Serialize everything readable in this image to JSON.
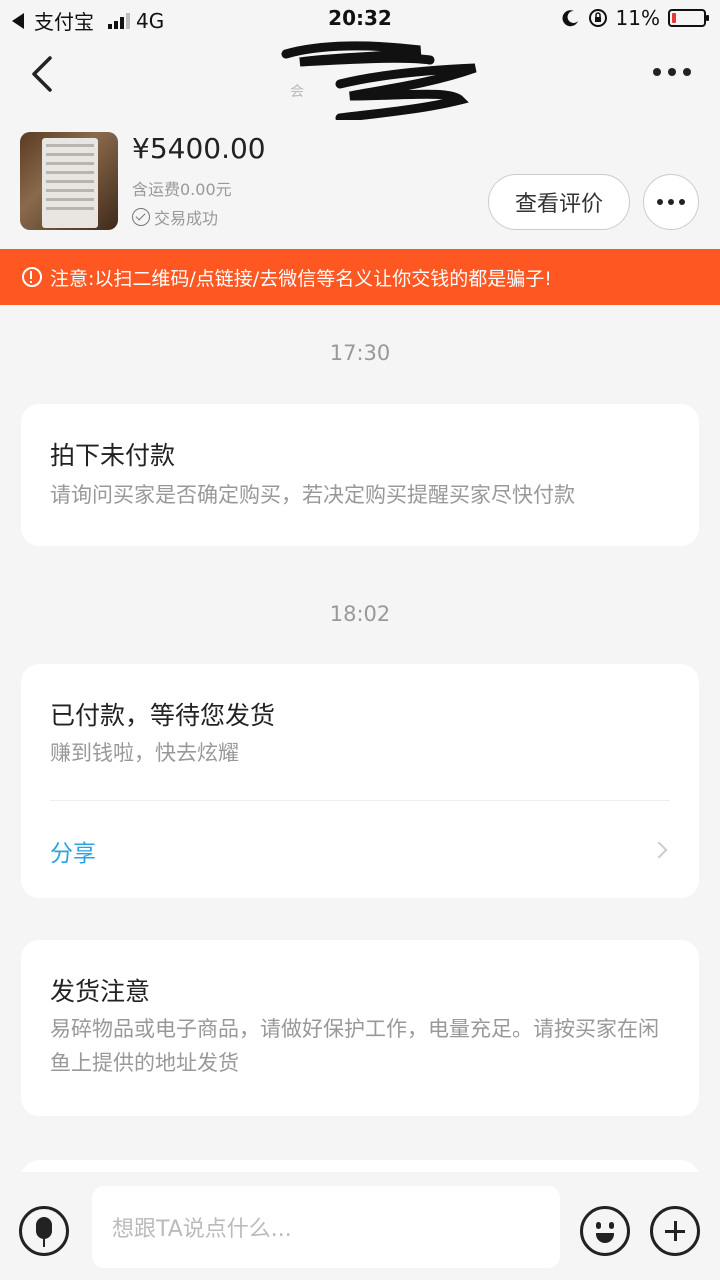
{
  "status_bar": {
    "carrier": "支付宝",
    "network": "4G",
    "time": "20:32",
    "battery": "11%"
  },
  "nav": {
    "title_redacted": true
  },
  "product": {
    "price": "¥5400.00",
    "shipping": "含运费0.00元",
    "status": "交易成功",
    "review_button": "查看评价"
  },
  "warning": {
    "text": "注意:以扫二维码/点链接/去微信等名义让你交钱的都是骗子!"
  },
  "messages": [
    {
      "time": "17:30",
      "title": "拍下未付款",
      "desc": "请询问买家是否确定购买，若决定购买提醒买家尽快付款"
    },
    {
      "time": "18:02",
      "title": "已付款，等待您发货",
      "desc": "赚到钱啦，快去炫耀",
      "action": "分享"
    },
    {
      "title": "发货注意",
      "desc": "易碎物品或电子商品，请做好保护工作，电量充足。请按买家在闲鱼上提供的地址发货"
    }
  ],
  "input": {
    "placeholder": "想跟TA说点什么..."
  },
  "colors": {
    "warning_bg": "#ff5722",
    "link": "#29a3e6",
    "battery_low": "#e53935"
  }
}
